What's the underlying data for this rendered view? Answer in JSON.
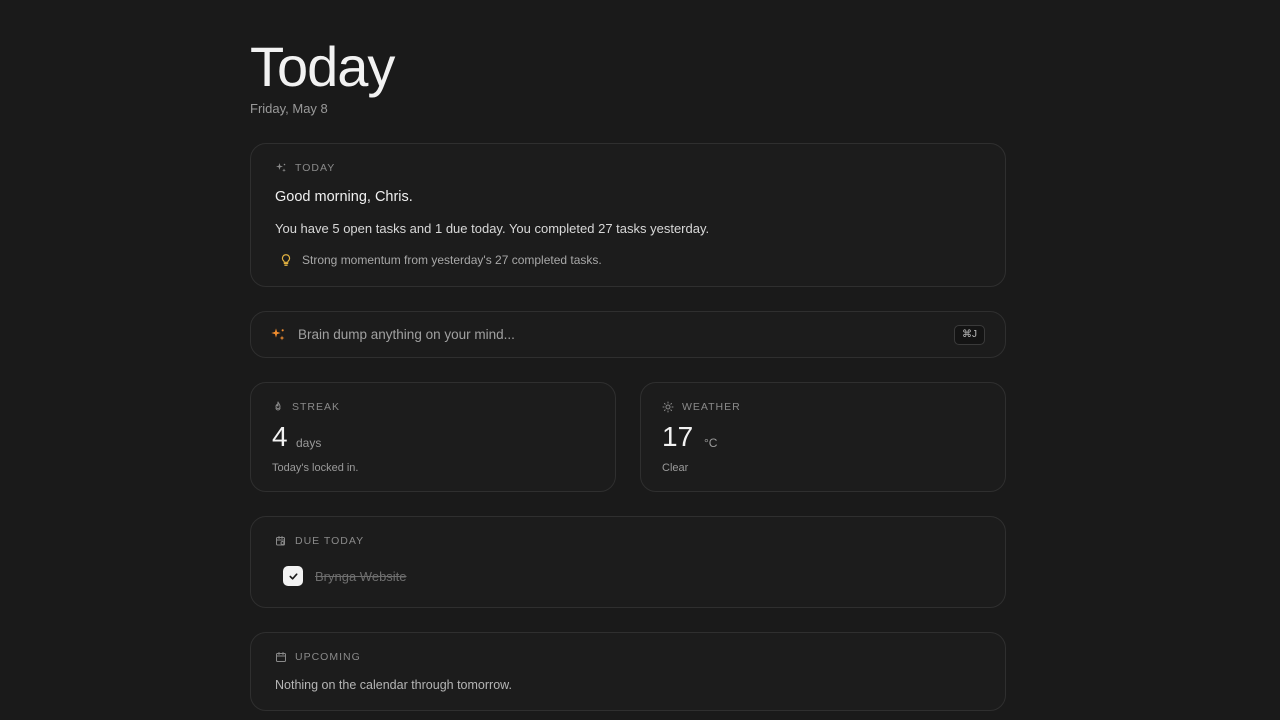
{
  "header": {
    "title": "Today",
    "date": "Friday, May 8"
  },
  "today_card": {
    "label": "TODAY",
    "greeting": "Good morning, Chris.",
    "summary": "You have 5 open tasks and 1 due today. You completed 27 tasks yesterday.",
    "insight": "Strong momentum from yesterday's 27 completed tasks.",
    "icon": "sparkle-icon",
    "insight_icon": "lightbulb-icon",
    "insight_color": "#e3b341"
  },
  "brain_dump": {
    "placeholder": "Brain dump anything on your mind...",
    "shortcut": "⌘J",
    "icon": "sparkle-icon",
    "icon_color": "#f08c2e"
  },
  "streak": {
    "label": "STREAK",
    "value": "4",
    "unit": "days",
    "caption": "Today's locked in.",
    "icon": "flame-icon"
  },
  "weather": {
    "label": "WEATHER",
    "value": "17",
    "unit": "°C",
    "caption": "Clear",
    "icon": "sun-icon"
  },
  "due_today": {
    "label": "DUE TODAY",
    "icon": "calendar-clock-icon",
    "tasks": [
      {
        "title": "Brynga Website",
        "completed": true
      }
    ]
  },
  "upcoming": {
    "label": "UPCOMING",
    "icon": "calendar-icon",
    "empty_text": "Nothing on the calendar through tomorrow."
  }
}
